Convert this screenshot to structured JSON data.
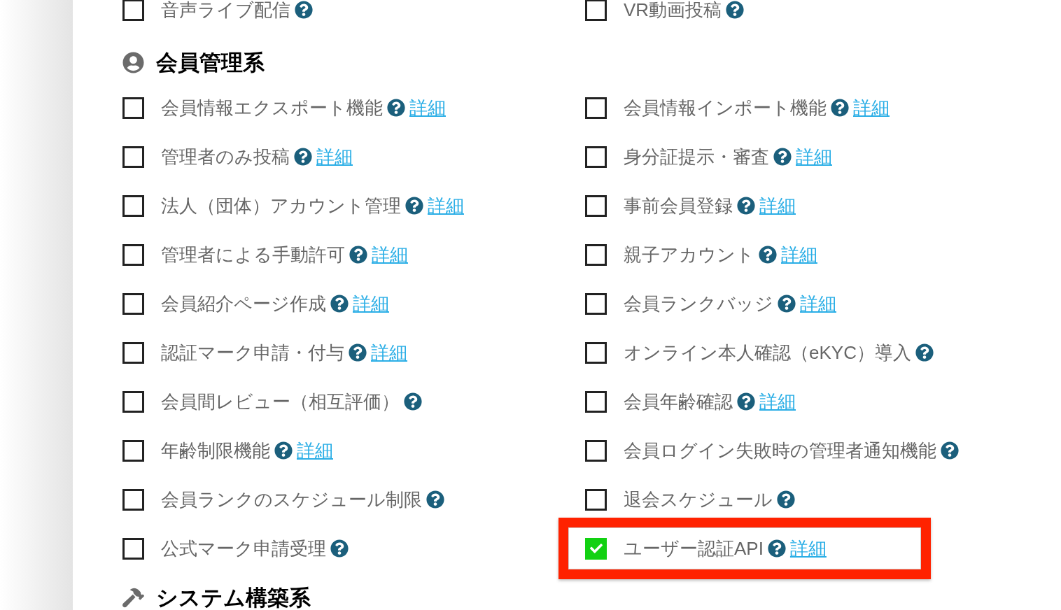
{
  "sections": [
    {
      "items": [
        {
          "label": "音声ライブ配信",
          "checked": false,
          "highlighted": false
        },
        {
          "label": "VR動画投稿",
          "checked": false,
          "highlighted": false
        }
      ]
    },
    {
      "title": "会員管理系",
      "kind": "members",
      "items": [
        {
          "label": "会員情報エクスポート機能",
          "checked": false,
          "highlighted": false,
          "link": "詳細"
        },
        {
          "label": "会員情報インポート機能",
          "checked": false,
          "highlighted": false,
          "link": "詳細"
        },
        {
          "label": "管理者のみ投稿",
          "checked": false,
          "highlighted": false,
          "link": "詳細"
        },
        {
          "label": "身分証提示・審査",
          "checked": false,
          "highlighted": false,
          "link": "詳細"
        },
        {
          "label": "法人（団体）アカウント管理",
          "checked": false,
          "highlighted": false,
          "link": "詳細"
        },
        {
          "label": "事前会員登録",
          "checked": false,
          "highlighted": false,
          "link": "詳細"
        },
        {
          "label": "管理者による手動許可",
          "checked": false,
          "highlighted": false,
          "link": "詳細"
        },
        {
          "label": "親子アカウント",
          "checked": false,
          "highlighted": false,
          "link": "詳細"
        },
        {
          "label": "会員紹介ページ作成",
          "checked": false,
          "highlighted": false,
          "link": "詳細"
        },
        {
          "label": "会員ランクバッジ",
          "checked": false,
          "highlighted": false,
          "link": "詳細"
        },
        {
          "label": "認証マーク申請・付与",
          "checked": false,
          "highlighted": false,
          "link": "詳細"
        },
        {
          "label": "オンライン本人確認（eKYC）導入",
          "checked": false,
          "highlighted": false
        },
        {
          "label": "会員間レビュー（相互評価）",
          "checked": false,
          "highlighted": false
        },
        {
          "label": "会員年齢確認",
          "checked": false,
          "highlighted": false,
          "link": "詳細"
        },
        {
          "label": "年齢制限機能",
          "checked": false,
          "highlighted": false,
          "link": "詳細"
        },
        {
          "label": "会員ログイン失敗時の管理者通知機能",
          "checked": false,
          "highlighted": false
        },
        {
          "label": "会員ランクのスケジュール制限",
          "checked": false,
          "highlighted": false
        },
        {
          "label": "退会スケジュール",
          "checked": false,
          "highlighted": false
        },
        {
          "label": "公式マーク申請受理",
          "checked": false,
          "highlighted": false
        },
        {
          "label": "ユーザー認証API",
          "checked": true,
          "highlighted": true,
          "link": "詳細"
        }
      ]
    },
    {
      "title": "システム構築系",
      "kind": "system"
    }
  ]
}
